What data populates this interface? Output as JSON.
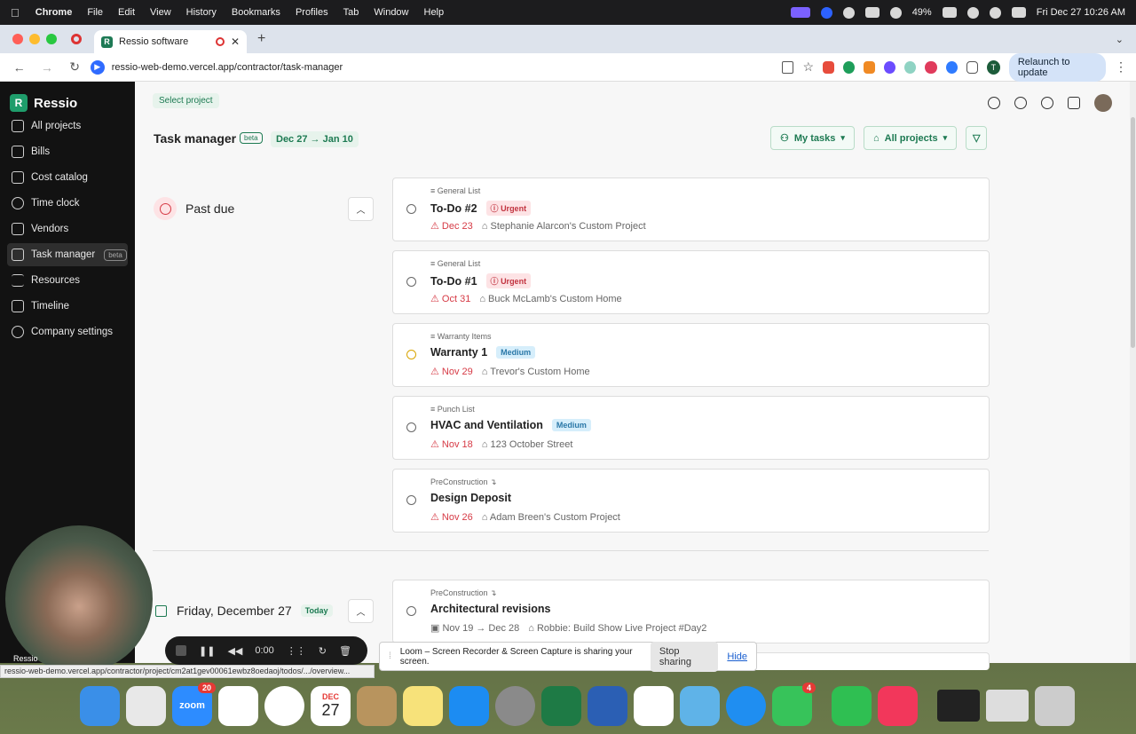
{
  "menubar": {
    "app": "Chrome",
    "items": [
      "File",
      "Edit",
      "View",
      "History",
      "Bookmarks",
      "Profiles",
      "Tab",
      "Window",
      "Help"
    ],
    "battery": "49%",
    "datetime": "Fri Dec 27  10:26 AM"
  },
  "browser": {
    "tab_title": "Ressio software",
    "url": "ressio-web-demo.vercel.app/contractor/task-manager",
    "relaunch": "Relaunch to update",
    "profile_initial": "T"
  },
  "sidebar": {
    "brand": "Ressio",
    "items": [
      {
        "label": "All projects",
        "icon": "home-icon"
      },
      {
        "label": "Bills",
        "icon": "dollar-icon"
      },
      {
        "label": "Cost catalog",
        "icon": "catalog-icon"
      },
      {
        "label": "Time clock",
        "icon": "stopwatch-icon"
      },
      {
        "label": "Vendors",
        "icon": "vendors-icon"
      },
      {
        "label": "Task manager",
        "icon": "calendar-check-icon",
        "badge": "beta",
        "active": true
      },
      {
        "label": "Resources",
        "icon": "list-icon"
      },
      {
        "label": "Timeline",
        "icon": "timeline-icon"
      },
      {
        "label": "Company settings",
        "icon": "gear-icon"
      }
    ]
  },
  "header": {
    "select_project": "Select project",
    "title": "Task manager",
    "beta": "beta",
    "date_range": "Dec 27 → Jan 10",
    "my_tasks": "My tasks",
    "all_projects": "All projects"
  },
  "groups": {
    "past_due": "Past due",
    "today_title": "Friday, December 27",
    "today_badge": "Today"
  },
  "tasks": [
    {
      "list": "General List",
      "name": "To-Do #2",
      "priority": "Urgent",
      "due": "Dec 23",
      "project": "Stephanie Alarcon's Custom Project"
    },
    {
      "list": "General List",
      "name": "To-Do #1",
      "priority": "Urgent",
      "due": "Oct 31",
      "project": "Buck McLamb's Custom Home"
    },
    {
      "list": "Warranty Items",
      "name": "Warranty 1",
      "priority": "Medium",
      "due": "Nov 29",
      "project": "Trevor's Custom Home"
    },
    {
      "list": "Punch List",
      "name": "HVAC and Ventilation",
      "priority": "Medium",
      "due": "Nov 18",
      "project": "123 October Street"
    },
    {
      "list": "PreConstruction ↴",
      "name": "Design Deposit",
      "priority": "",
      "due": "Nov 26",
      "project": "Adam Breen's Custom Project"
    }
  ],
  "today_tasks": [
    {
      "list": "PreConstruction ↴",
      "name": "Architectural revisions",
      "due": "Nov 19 → Dec 28",
      "project": "Robbie: Build Show Live Project #Day2"
    }
  ],
  "loom": {
    "time": "0:00",
    "share_text": "Loom – Screen Recorder & Screen Capture is sharing your screen.",
    "stop": "Stop sharing",
    "hide": "Hide",
    "cam_label": "Ressio"
  },
  "status_url": "ressio-web-demo.vercel.app/contractor/project/cm2at1gev00061ewbz8oedaoj/todos/.../overview...",
  "dock": {
    "zoom_badge": "20",
    "calendar_month": "DEC",
    "calendar_day": "27",
    "messages_badge": "4"
  }
}
